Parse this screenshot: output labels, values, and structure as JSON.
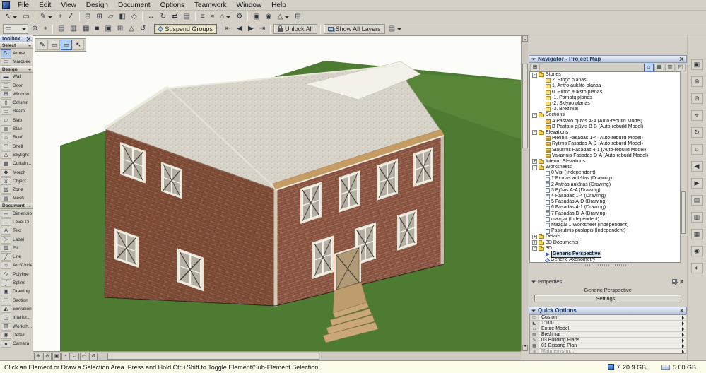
{
  "colors": {
    "chrome": "#d4d0c8",
    "selection_blue": "#b8d2f2",
    "lawn_green": "#4d7b32",
    "brick": "#86523b",
    "roof_gray": "#d8d4ca",
    "eave_tan": "#c59c64",
    "status_bg": "#fdfceb",
    "title_text": "#1c3a66"
  },
  "menu": {
    "items": [
      "File",
      "Edit",
      "View",
      "Design",
      "Document",
      "Options",
      "Teamwork",
      "Window",
      "Help"
    ]
  },
  "toolbar1": {
    "items": [
      {
        "cls": "dd",
        "name": "arrow-icon",
        "glyph": "↖"
      },
      {
        "cls": "",
        "name": "marquee-icon",
        "glyph": "▭"
      },
      {
        "cls": "sep"
      },
      {
        "cls": "dd",
        "name": "pencil-icon",
        "glyph": "✎"
      },
      {
        "cls": "",
        "name": "plus-icon",
        "glyph": "+"
      },
      {
        "cls": "",
        "name": "angle-icon",
        "glyph": "∠"
      },
      {
        "cls": "sep"
      },
      {
        "cls": "",
        "name": "subtract-box-icon",
        "glyph": "⊟"
      },
      {
        "cls": "",
        "name": "add-box-icon",
        "glyph": "⊞"
      },
      {
        "cls": "",
        "name": "slab-icon",
        "glyph": "▱"
      },
      {
        "cls": "",
        "name": "half-square-icon",
        "glyph": "◧"
      },
      {
        "cls": "",
        "name": "diamond-icon",
        "glyph": "◇"
      },
      {
        "cls": "sep"
      },
      {
        "cls": "",
        "name": "stretch-icon",
        "glyph": "↔"
      },
      {
        "cls": "",
        "name": "rotate-icon",
        "glyph": "↻"
      },
      {
        "cls": "",
        "name": "mirror-icon",
        "glyph": "⇄"
      },
      {
        "cls": "",
        "name": "align-icon",
        "glyph": "▤"
      },
      {
        "cls": "sep"
      },
      {
        "cls": "",
        "name": "list-icon",
        "glyph": "≡"
      },
      {
        "cls": "",
        "name": "wave-icon",
        "glyph": "≈"
      },
      {
        "cls": "dd",
        "name": "home-icon",
        "glyph": "⌂"
      },
      {
        "cls": "",
        "name": "gear-icon",
        "glyph": "⚙"
      },
      {
        "cls": "sep"
      },
      {
        "cls": "",
        "name": "fit-frame-icon",
        "glyph": "▣"
      },
      {
        "cls": "",
        "name": "target-icon",
        "glyph": "◉"
      },
      {
        "cls": "dd",
        "name": "triangle-icon",
        "glyph": "△"
      },
      {
        "cls": "",
        "name": "grid-icon",
        "glyph": "⊞"
      }
    ]
  },
  "toolbar2": {
    "items": [
      {
        "cls": "wide dd",
        "name": "view-selector-icon",
        "glyph": "▭"
      },
      {
        "cls": "",
        "name": "zoom-in-icon",
        "glyph": "⊕"
      },
      {
        "cls": "",
        "name": "snap-target-icon",
        "glyph": "⌖"
      },
      {
        "cls": "sep"
      },
      {
        "cls": "",
        "name": "layout-icon",
        "glyph": "▤"
      },
      {
        "cls": "",
        "name": "sheet-icon",
        "glyph": "▥"
      },
      {
        "cls": "",
        "name": "grid-sheet-icon",
        "glyph": "▦"
      },
      {
        "cls": "",
        "name": "solid-square-icon",
        "glyph": "■"
      },
      {
        "cls": "",
        "name": "frame-icon",
        "glyph": "▣"
      },
      {
        "cls": "",
        "name": "plus-box-icon",
        "glyph": "⊞"
      },
      {
        "cls": "",
        "name": "triangle-icon",
        "glyph": "△"
      },
      {
        "cls": "",
        "name": "undo-icon",
        "glyph": "↺"
      },
      {
        "cls": "sep"
      },
      {
        "cls": "tbtn pressed",
        "name": "suspend-groups-button",
        "ico": "diamond",
        "label": "Suspend Groups"
      },
      {
        "cls": "sep"
      },
      {
        "cls": "",
        "name": "go-first-icon",
        "glyph": "⇤"
      },
      {
        "cls": "",
        "name": "back-icon",
        "glyph": "◀"
      },
      {
        "cls": "",
        "name": "forward-icon",
        "glyph": "▶"
      },
      {
        "cls": "",
        "name": "go-last-icon",
        "glyph": "⇥"
      },
      {
        "cls": "sep"
      },
      {
        "cls": "tbtn",
        "name": "unlock-all-button",
        "ico": "lock",
        "label": "Unlock All"
      },
      {
        "cls": "sep"
      },
      {
        "cls": "tbtn",
        "name": "show-all-layers-button",
        "ico": "layers",
        "label": "Show All Layers"
      },
      {
        "cls": "dd",
        "name": "layers-menu-icon",
        "glyph": "▤"
      }
    ]
  },
  "minibar": {
    "items": [
      {
        "cls": "",
        "name": "pencil-icon",
        "glyph": "✎"
      },
      {
        "cls": "",
        "name": "view-tab-icon",
        "glyph": "▭"
      },
      {
        "cls": "active",
        "name": "active-view-tab-icon",
        "glyph": "▭"
      },
      {
        "cls": "",
        "name": "cursor-icon",
        "glyph": "↖"
      }
    ]
  },
  "toolbox": {
    "title": "Toolbox",
    "rows": [
      {
        "cls": "tbx-hdr",
        "name": "toolbox-group-select",
        "label": "Select"
      },
      {
        "cls": "tbx-item on",
        "name": "tool-arrow",
        "label": "Arrow",
        "glyph": "↖"
      },
      {
        "cls": "tbx-item",
        "name": "tool-marquee",
        "label": "Marquee",
        "glyph": "▭"
      },
      {
        "cls": "tbx-hdr",
        "name": "toolbox-group-design",
        "label": "Design"
      },
      {
        "cls": "tbx-item",
        "name": "tool-wall",
        "label": "Wall",
        "glyph": "▬"
      },
      {
        "cls": "tbx-item",
        "name": "tool-door",
        "label": "Door",
        "glyph": "◫"
      },
      {
        "cls": "tbx-item",
        "name": "tool-window",
        "label": "Window",
        "glyph": "⊞"
      },
      {
        "cls": "tbx-item",
        "name": "tool-column",
        "label": "Column",
        "glyph": "▯"
      },
      {
        "cls": "tbx-item",
        "name": "tool-beam",
        "label": "Beam",
        "glyph": "▭"
      },
      {
        "cls": "tbx-item",
        "name": "tool-slab",
        "label": "Slab",
        "glyph": "▱"
      },
      {
        "cls": "tbx-item",
        "name": "tool-stair",
        "label": "Stair",
        "glyph": "≣"
      },
      {
        "cls": "tbx-item",
        "name": "tool-roof",
        "label": "Roof",
        "glyph": "⌂"
      },
      {
        "cls": "tbx-item",
        "name": "tool-shell",
        "label": "Shell",
        "glyph": "◠"
      },
      {
        "cls": "tbx-item",
        "name": "tool-skylight",
        "label": "Skylight",
        "glyph": "◬"
      },
      {
        "cls": "tbx-item",
        "name": "tool-curtain-wall",
        "label": "Curtain...",
        "glyph": "▦"
      },
      {
        "cls": "tbx-item",
        "name": "tool-morph",
        "label": "Morph",
        "glyph": "◆"
      },
      {
        "cls": "tbx-item",
        "name": "tool-object",
        "label": "Object",
        "glyph": "◎"
      },
      {
        "cls": "tbx-item",
        "name": "tool-zone",
        "label": "Zone",
        "glyph": "▨"
      },
      {
        "cls": "tbx-item",
        "name": "tool-mesh",
        "label": "Mesh",
        "glyph": "▤"
      },
      {
        "cls": "tbx-hdr",
        "name": "toolbox-group-document",
        "label": "Document"
      },
      {
        "cls": "tbx-item",
        "name": "tool-dimension",
        "label": "Dimension",
        "glyph": "↔"
      },
      {
        "cls": "tbx-item",
        "name": "tool-level-dimension",
        "label": "Level Di...",
        "glyph": "⊥"
      },
      {
        "cls": "tbx-item",
        "name": "tool-text",
        "label": "Text",
        "glyph": "A"
      },
      {
        "cls": "tbx-item",
        "name": "tool-label",
        "label": "Label",
        "glyph": "▷"
      },
      {
        "cls": "tbx-item",
        "name": "tool-fill",
        "label": "Fill",
        "glyph": "▨"
      },
      {
        "cls": "tbx-item",
        "name": "tool-line",
        "label": "Line",
        "glyph": "╱"
      },
      {
        "cls": "tbx-item",
        "name": "tool-arc-circle",
        "label": "Arc/Circle",
        "glyph": "○"
      },
      {
        "cls": "tbx-item",
        "name": "tool-polyline",
        "label": "Polyline",
        "glyph": "∿"
      },
      {
        "cls": "tbx-item",
        "name": "tool-spline",
        "label": "Spline",
        "glyph": "∫"
      },
      {
        "cls": "tbx-item",
        "name": "tool-drawing",
        "label": "Drawing",
        "glyph": "▣"
      },
      {
        "cls": "tbx-item",
        "name": "tool-section",
        "label": "Section",
        "glyph": "◫"
      },
      {
        "cls": "tbx-item",
        "name": "tool-elevation",
        "label": "Elevation",
        "glyph": "◭"
      },
      {
        "cls": "tbx-item",
        "name": "tool-interior-elevation",
        "label": "Interior...",
        "glyph": "◲"
      },
      {
        "cls": "tbx-item",
        "name": "tool-worksheet",
        "label": "Worksh...",
        "glyph": "▥"
      },
      {
        "cls": "tbx-item",
        "name": "tool-detail",
        "label": "Detail",
        "glyph": "◉"
      },
      {
        "cls": "tbx-item",
        "name": "tool-camera",
        "label": "Camera",
        "glyph": "●"
      }
    ]
  },
  "navigator": {
    "title": "Navigator - Project Map",
    "toolbar_left": [
      {
        "name": "undock-icon",
        "glyph": "⊞"
      }
    ],
    "toolbar_right": [
      {
        "cls": "active",
        "name": "project-map-icon",
        "glyph": "⌂"
      },
      {
        "cls": "",
        "name": "view-map-icon",
        "glyph": "▦"
      },
      {
        "cls": "",
        "name": "layout-book-icon",
        "glyph": "▥"
      },
      {
        "cls": "",
        "name": "publisher-icon",
        "glyph": "◰"
      }
    ],
    "tree": [
      {
        "label": "Stories",
        "level": 0,
        "ico": "folder",
        "exp": "-",
        "name": "tree-stories"
      },
      {
        "label": "2. Stogo planas",
        "level": 1,
        "ico": "story"
      },
      {
        "label": "1. Antro aukšto planas",
        "level": 1,
        "ico": "story"
      },
      {
        "label": "0. Pirmo aukšto planas",
        "level": 1,
        "ico": "story"
      },
      {
        "label": "-1. Pamatų planas",
        "level": 1,
        "ico": "story"
      },
      {
        "label": "-2. Sklypo planas",
        "level": 1,
        "ico": "story"
      },
      {
        "label": "-3. Brėžiniai",
        "level": 1,
        "ico": "story"
      },
      {
        "label": "Sections",
        "level": 0,
        "ico": "folder",
        "exp": "-",
        "name": "tree-sections"
      },
      {
        "label": "A Pastato pjūvis A-A (Auto-rebuild Model)",
        "level": 1,
        "ico": "section"
      },
      {
        "label": "B Pastato pjūvis B-B (Auto-rebuild Model)",
        "level": 1,
        "ico": "section"
      },
      {
        "label": "Elevations",
        "level": 0,
        "ico": "folder",
        "exp": "-",
        "name": "tree-elevations"
      },
      {
        "label": "Pietinis Fasadas 1-4 (Auto-rebuild Model)",
        "level": 1,
        "ico": "elev"
      },
      {
        "label": "Rytinis Fasadas A-D (Auto-rebuild Model)",
        "level": 1,
        "ico": "elev"
      },
      {
        "label": "Šiaurinis Fasadas 4-1 (Auto-rebuild Model)",
        "level": 1,
        "ico": "elev"
      },
      {
        "label": "Vakarinis Fasadas D-A (Auto-rebuild Model)",
        "level": 1,
        "ico": "elev"
      },
      {
        "label": "Interior Elevations",
        "level": 0,
        "ico": "folder",
        "exp": "+",
        "name": "tree-interior-elevations"
      },
      {
        "label": "Worksheets",
        "level": 0,
        "ico": "folder",
        "exp": "-",
        "name": "tree-worksheets"
      },
      {
        "label": "0 Visi (Independent)",
        "level": 1,
        "ico": "ws"
      },
      {
        "label": "1 Pirmas aukštas (Drawing)",
        "level": 1,
        "ico": "ws"
      },
      {
        "label": "2 Antras aukštas (Drawing)",
        "level": 1,
        "ico": "ws"
      },
      {
        "label": "3 Pjūvis A-A (Drawing)",
        "level": 1,
        "ico": "ws"
      },
      {
        "label": "4 Fasadas 1-4 (Drawing)",
        "level": 1,
        "ico": "ws"
      },
      {
        "label": "5 Fasadas A-D (Drawing)",
        "level": 1,
        "ico": "ws"
      },
      {
        "label": "6 Fasadas 4-1 (Drawing)",
        "level": 1,
        "ico": "ws"
      },
      {
        "label": "7 Fasadas D-A (Drawing)",
        "level": 1,
        "ico": "ws"
      },
      {
        "label": "mazgai (Independent)",
        "level": 1,
        "ico": "ws"
      },
      {
        "label": "Mazgai 1 Worksheet (Independent)",
        "level": 1,
        "ico": "ws"
      },
      {
        "label": "Paskutinis puslapis (Independent)",
        "level": 1,
        "ico": "ws"
      },
      {
        "label": "Details",
        "level": 0,
        "ico": "folder",
        "exp": "+",
        "name": "tree-details"
      },
      {
        "label": "3D Documents",
        "level": 0,
        "ico": "folder",
        "exp": "+",
        "name": "tree-3d-documents"
      },
      {
        "label": "3D",
        "level": 0,
        "ico": "folder",
        "exp": "-",
        "name": "tree-3d"
      },
      {
        "label": "Generic Perspective",
        "level": 1,
        "ico": "persp",
        "cls": "sel",
        "name": "tree-generic-perspective"
      },
      {
        "label": "Generic Axonometry",
        "level": 1,
        "ico": "axon",
        "name": "tree-generic-axonometry"
      }
    ]
  },
  "properties": {
    "header": "Properties",
    "value": "Generic Perspective",
    "settings_label": "Settings..."
  },
  "quick_options": {
    "title": "Quick Options",
    "rows": [
      {
        "name": "qo-model-view-options",
        "label": "Custom",
        "glyph": "▭"
      },
      {
        "name": "qo-scale",
        "label": "1:100",
        "glyph": "◣"
      },
      {
        "name": "qo-structure-display",
        "label": "Entire Model",
        "glyph": "⌂"
      },
      {
        "name": "qo-layer-combination",
        "label": "Brėžiniai",
        "glyph": "▤"
      },
      {
        "name": "qo-pen-set",
        "label": "03 Building Plans",
        "glyph": "✎"
      },
      {
        "name": "qo-renovation-filter",
        "label": "01 Existing Plan",
        "glyph": "▦"
      },
      {
        "cls": "dim",
        "name": "qo-dimension-style",
        "label": "Matmenys-m...",
        "glyph": "≡"
      }
    ]
  },
  "right_strip": {
    "items": [
      {
        "name": "fit-in-window-icon",
        "glyph": "▣"
      },
      {
        "name": "zoom-in-icon",
        "glyph": "⊕"
      },
      {
        "name": "zoom-out-icon",
        "glyph": "⊖"
      },
      {
        "name": "pan-icon",
        "glyph": "⌖"
      },
      {
        "name": "orbit-icon",
        "glyph": "↻"
      },
      {
        "name": "home-view-icon",
        "glyph": "⌂"
      },
      {
        "name": "previous-view-icon",
        "glyph": "◀"
      },
      {
        "name": "next-view-icon",
        "glyph": "▶"
      },
      {
        "name": "panel-layers-icon",
        "glyph": "▤"
      },
      {
        "name": "panel-sheets-icon",
        "glyph": "▥"
      },
      {
        "name": "panel-library-icon",
        "glyph": "▦"
      },
      {
        "name": "camera-icon",
        "glyph": "◉"
      },
      {
        "name": "shadow-icon",
        "glyph": "◐"
      }
    ]
  },
  "hscroll_tools": {
    "items": [
      {
        "name": "zoom-in-icon",
        "glyph": "⊕"
      },
      {
        "name": "zoom-out-icon",
        "glyph": "⊖"
      },
      {
        "name": "fit-in-window-icon",
        "glyph": "▣"
      },
      {
        "name": "pan-icon",
        "glyph": "⌖"
      },
      {
        "name": "fit-width-icon",
        "glyph": "↔"
      },
      {
        "name": "zoom-box-icon",
        "glyph": "▭"
      },
      {
        "name": "previous-zoom-icon",
        "glyph": "↺"
      }
    ]
  },
  "status_bar": {
    "message": "Click an Element or Draw a Selection Area. Press and Hold Ctrl+Shift to Toggle Element/Sub-Element Selection.",
    "memory_total": "Σ 20.9 GB",
    "memory_free": "5.00 GB"
  }
}
